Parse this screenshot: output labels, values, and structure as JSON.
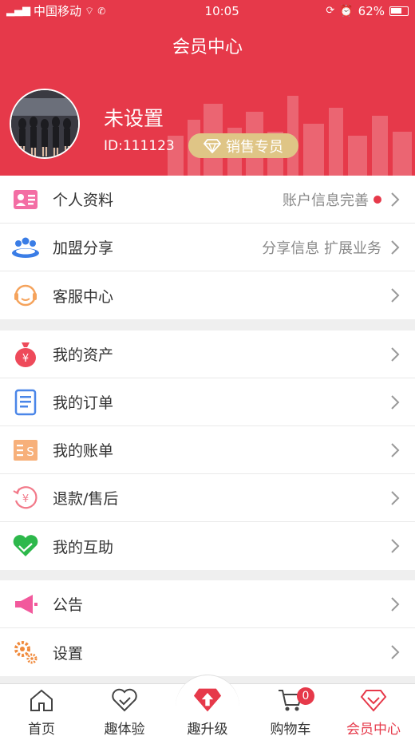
{
  "status_bar": {
    "carrier": "中国移动",
    "time": "10:05",
    "battery": "62%"
  },
  "header": {
    "title": "会员中心",
    "user_name": "未设置",
    "user_id": "ID:111123",
    "badge_label": "销售专员"
  },
  "groups": [
    {
      "items": [
        {
          "name": "personal-info",
          "label": "个人资料",
          "value": "账户信息完善",
          "dot": true,
          "icon": "id-card-icon"
        },
        {
          "name": "join-share",
          "label": "加盟分享",
          "value": "分享信息 扩展业务",
          "dot": false,
          "icon": "group-people-icon"
        },
        {
          "name": "customer-service",
          "label": "客服中心",
          "value": "",
          "dot": false,
          "icon": "headset-icon"
        }
      ]
    },
    {
      "items": [
        {
          "name": "my-assets",
          "label": "我的资产",
          "value": "",
          "dot": false,
          "icon": "money-bag-icon"
        },
        {
          "name": "my-orders",
          "label": "我的订单",
          "value": "",
          "dot": false,
          "icon": "document-icon"
        },
        {
          "name": "my-bills",
          "label": "我的账单",
          "value": "",
          "dot": false,
          "icon": "bill-icon"
        },
        {
          "name": "refund",
          "label": "退款/售后",
          "value": "",
          "dot": false,
          "icon": "refund-icon"
        },
        {
          "name": "mutual-aid",
          "label": "我的互助",
          "value": "",
          "dot": false,
          "icon": "heart-hands-icon"
        }
      ]
    },
    {
      "items": [
        {
          "name": "announcement",
          "label": "公告",
          "value": "",
          "dot": false,
          "icon": "megaphone-icon"
        },
        {
          "name": "settings",
          "label": "设置",
          "value": "",
          "dot": false,
          "icon": "gear-icon"
        }
      ]
    }
  ],
  "tabbar": {
    "home": "首页",
    "experience": "趣体验",
    "upgrade": "趣升级",
    "cart": "购物车",
    "cart_count": "0",
    "member": "会员中心"
  },
  "colors": {
    "accent": "#e6394a",
    "badge": "#dfc586"
  }
}
